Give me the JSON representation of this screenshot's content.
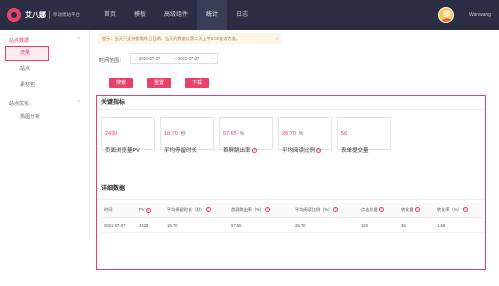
{
  "brand": {
    "name": "艾八娜",
    "subtitle": "移动建站平台"
  },
  "nav": [
    "首页",
    "模板",
    "高级组件",
    "统计",
    "日志"
  ],
  "user": {
    "name": "Wanwang"
  },
  "sidebar": {
    "group1": "站点数据",
    "items": [
      "流量",
      "站点",
      "素材包"
    ],
    "group2": "站点优化",
    "items2": [
      "热图分析"
    ],
    "caret": "^"
  },
  "notice": {
    "text": "提示：当天只支持查看昨日日期，当天的数据以第二天上午6:00查询为准。",
    "close": "×"
  },
  "filter": {
    "label": "时间范围：",
    "start": "2021-07-07",
    "end": "2021-07-07",
    "separator": "—",
    "buttons": [
      "搜索",
      "重置",
      "下载"
    ]
  },
  "kpi_panel": {
    "title": "关键指标",
    "cards": [
      {
        "value": "2439",
        "unit": "",
        "label": "页面浏览量PV",
        "help": false
      },
      {
        "value": "18.70",
        "unit": "秒",
        "label": "平均停留时长",
        "help": false
      },
      {
        "value": "57.65",
        "unit": "%",
        "label": "首屏跳出率",
        "help": true
      },
      {
        "value": "28.70",
        "unit": "%",
        "label": "平均阅读比例",
        "help": true
      },
      {
        "value": "56",
        "unit": "",
        "label": "表单提交量",
        "help": false
      }
    ]
  },
  "detail_panel": {
    "title": "详细数据",
    "headers": [
      "时间",
      "PV",
      "平均停留时长（秒）",
      "首屏跳出率（%）",
      "平均阅读比例（%）",
      "点击总量",
      "转化量",
      "转化率（%）"
    ],
    "rows": [
      [
        "2021-07-07",
        "2439",
        "18.70",
        "57.65",
        "28.70",
        "163",
        "36",
        "1.56"
      ]
    ]
  },
  "colors": {
    "accent": "#e8426b",
    "topbar": "#2b2d42"
  }
}
